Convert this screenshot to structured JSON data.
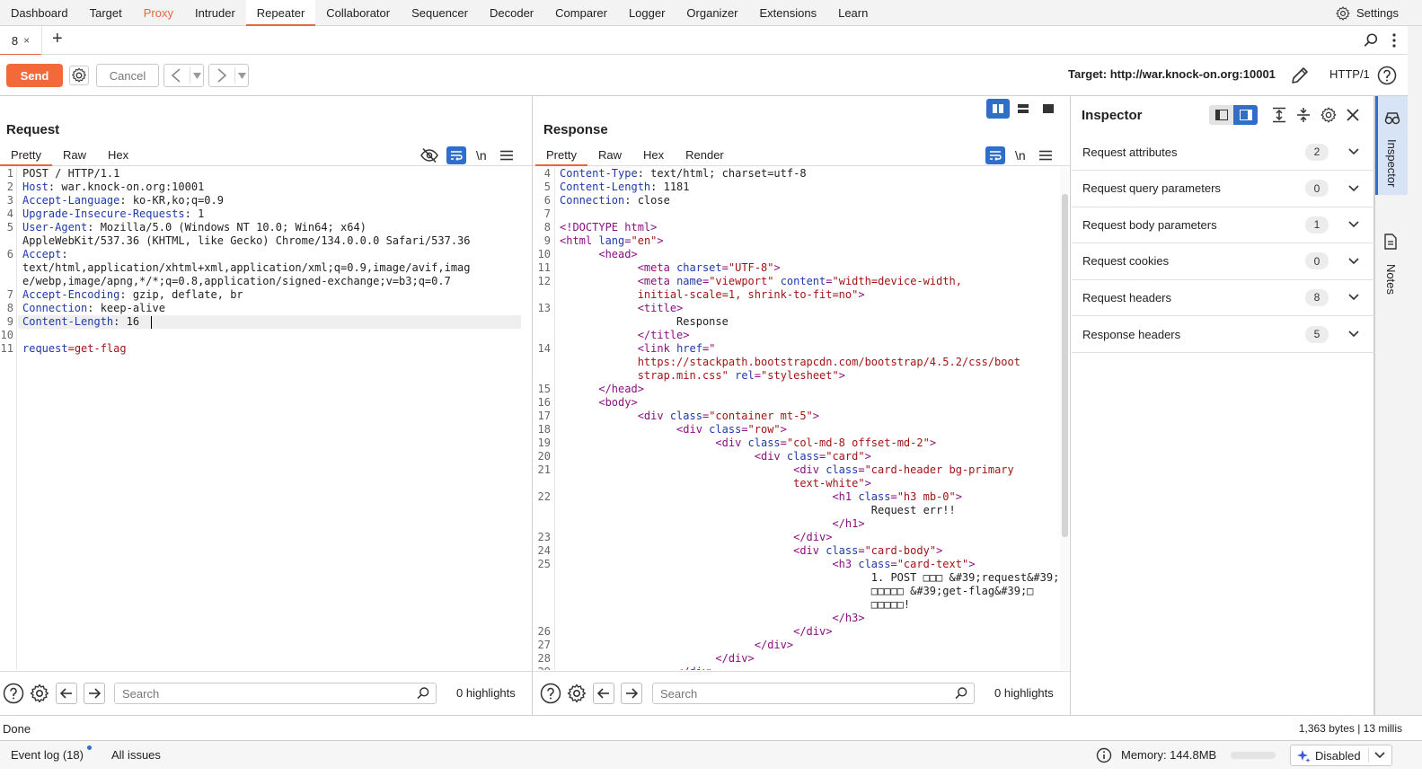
{
  "nav": {
    "tabs": [
      "Dashboard",
      "Target",
      "Proxy",
      "Intruder",
      "Repeater",
      "Collaborator",
      "Sequencer",
      "Decoder",
      "Comparer",
      "Logger",
      "Organizer",
      "Extensions",
      "Learn"
    ],
    "active": "Repeater",
    "highlighted": "Proxy",
    "settings": "Settings"
  },
  "tabstrip": {
    "tab_label": "8",
    "close": "×",
    "add": "+"
  },
  "toolbar": {
    "send": "Send",
    "cancel": "Cancel",
    "target": "Target: http://war.knock-on.org:10001",
    "protocol": "HTTP/1"
  },
  "request": {
    "title": "Request",
    "tabs": [
      "Pretty",
      "Raw",
      "Hex"
    ],
    "active_tab": "Pretty",
    "newline_label": "\\n",
    "lines": [
      {
        "n": "1",
        "parts": [
          [
            "POST / HTTP/1.1",
            ""
          ]
        ]
      },
      {
        "n": "2",
        "parts": [
          [
            "Host",
            "key"
          ],
          [
            ": war.knock-on.org:10001",
            ""
          ]
        ]
      },
      {
        "n": "3",
        "parts": [
          [
            "Accept-Language",
            "key"
          ],
          [
            ": ko-KR,ko;q=0.9",
            ""
          ]
        ]
      },
      {
        "n": "4",
        "parts": [
          [
            "Upgrade-Insecure-Requests",
            "key"
          ],
          [
            ": 1",
            ""
          ]
        ]
      },
      {
        "n": "5",
        "parts": [
          [
            "User-Agent",
            "key"
          ],
          [
            ": Mozilla/5.0 (Windows NT 10.0; Win64; x64)",
            ""
          ]
        ]
      },
      {
        "n": "",
        "parts": [
          [
            "AppleWebKit/537.36 (KHTML, like Gecko) Chrome/134.0.0.0 Safari/537.36",
            ""
          ]
        ]
      },
      {
        "n": "6",
        "parts": [
          [
            "Accept",
            "key"
          ],
          [
            ":",
            ""
          ]
        ]
      },
      {
        "n": "",
        "parts": [
          [
            "text/html,application/xhtml+xml,application/xml;q=0.9,image/avif,imag",
            ""
          ]
        ]
      },
      {
        "n": "",
        "parts": [
          [
            "e/webp,image/apng,*/*;q=0.8,application/signed-exchange;v=b3;q=0.7",
            ""
          ]
        ]
      },
      {
        "n": "7",
        "parts": [
          [
            "Accept-Encoding",
            "key"
          ],
          [
            ": gzip, deflate, br",
            ""
          ]
        ]
      },
      {
        "n": "8",
        "parts": [
          [
            "Connection",
            "key"
          ],
          [
            ": keep-alive",
            ""
          ]
        ]
      },
      {
        "n": "9",
        "parts": [
          [
            "Content-Length",
            "key"
          ],
          [
            ": 16",
            ""
          ]
        ]
      },
      {
        "n": "10",
        "parts": [
          [
            "",
            ""
          ]
        ]
      },
      {
        "n": "11",
        "parts": [
          [
            "request",
            "key"
          ],
          [
            "=",
            "str"
          ],
          [
            "get-flag",
            "str"
          ]
        ]
      }
    ],
    "search_placeholder": "Search",
    "highlights": "0 highlights"
  },
  "response": {
    "title": "Response",
    "tabs": [
      "Pretty",
      "Raw",
      "Hex",
      "Render"
    ],
    "active_tab": "Pretty",
    "newline_label": "\\n",
    "lines": [
      {
        "n": "4",
        "parts": [
          [
            "Content-Type",
            "key"
          ],
          [
            ": text/html; charset=utf-8",
            ""
          ]
        ]
      },
      {
        "n": "5",
        "parts": [
          [
            "Content-Length",
            "key"
          ],
          [
            ": 1181",
            ""
          ]
        ]
      },
      {
        "n": "6",
        "parts": [
          [
            "Connection",
            "key"
          ],
          [
            ": close",
            ""
          ]
        ]
      },
      {
        "n": "7",
        "parts": [
          [
            "",
            ""
          ]
        ]
      },
      {
        "n": "8",
        "parts": [
          [
            "<!DOCTYPE html>",
            "tag"
          ]
        ]
      },
      {
        "n": "9",
        "parts": [
          [
            "<html ",
            "tag"
          ],
          [
            "lang",
            "attr"
          ],
          [
            "=",
            "tag"
          ],
          [
            "\"en\"",
            "val"
          ],
          [
            ">",
            "tag"
          ]
        ]
      },
      {
        "n": "10",
        "parts": [
          [
            "      ",
            ""
          ],
          [
            "<head>",
            "tag"
          ]
        ]
      },
      {
        "n": "11",
        "parts": [
          [
            "            ",
            ""
          ],
          [
            "<meta ",
            "tag"
          ],
          [
            "charset",
            "attr"
          ],
          [
            "=",
            "tag"
          ],
          [
            "\"UTF-8\"",
            "val"
          ],
          [
            ">",
            "tag"
          ]
        ]
      },
      {
        "n": "12",
        "parts": [
          [
            "            ",
            ""
          ],
          [
            "<meta ",
            "tag"
          ],
          [
            "name",
            "attr"
          ],
          [
            "=",
            "tag"
          ],
          [
            "\"viewport\"",
            "val"
          ],
          [
            " ",
            ""
          ],
          [
            "content",
            "attr"
          ],
          [
            "=",
            "tag"
          ],
          [
            "\"width=device-width,",
            "val"
          ]
        ]
      },
      {
        "n": "",
        "parts": [
          [
            "            ",
            ""
          ],
          [
            "initial-scale=1, shrink-to-fit=no\"",
            "val"
          ],
          [
            ">",
            "tag"
          ]
        ]
      },
      {
        "n": "13",
        "parts": [
          [
            "            ",
            ""
          ],
          [
            "<title>",
            "tag"
          ]
        ]
      },
      {
        "n": "",
        "parts": [
          [
            "                  Response",
            ""
          ]
        ]
      },
      {
        "n": "",
        "parts": [
          [
            "            ",
            ""
          ],
          [
            "</title>",
            "tag"
          ]
        ]
      },
      {
        "n": "14",
        "parts": [
          [
            "            ",
            ""
          ],
          [
            "<link ",
            "tag"
          ],
          [
            "href",
            "attr"
          ],
          [
            "=\"",
            "tag"
          ]
        ]
      },
      {
        "n": "",
        "parts": [
          [
            "            ",
            ""
          ],
          [
            "https://stackpath.bootstrapcdn.com/bootstrap/4.5.2/css/boot",
            "val"
          ]
        ]
      },
      {
        "n": "",
        "parts": [
          [
            "            ",
            ""
          ],
          [
            "strap.min.css\"",
            "val"
          ],
          [
            " ",
            ""
          ],
          [
            "rel",
            "attr"
          ],
          [
            "=",
            "tag"
          ],
          [
            "\"stylesheet\"",
            "val"
          ],
          [
            ">",
            "tag"
          ]
        ]
      },
      {
        "n": "15",
        "parts": [
          [
            "      ",
            ""
          ],
          [
            "</head>",
            "tag"
          ]
        ]
      },
      {
        "n": "16",
        "parts": [
          [
            "      ",
            ""
          ],
          [
            "<body>",
            "tag"
          ]
        ]
      },
      {
        "n": "17",
        "parts": [
          [
            "            ",
            ""
          ],
          [
            "<div ",
            "tag"
          ],
          [
            "class",
            "attr"
          ],
          [
            "=",
            "tag"
          ],
          [
            "\"container mt-5\"",
            "val"
          ],
          [
            ">",
            "tag"
          ]
        ]
      },
      {
        "n": "18",
        "parts": [
          [
            "                  ",
            ""
          ],
          [
            "<div ",
            "tag"
          ],
          [
            "class",
            "attr"
          ],
          [
            "=",
            "tag"
          ],
          [
            "\"row\"",
            "val"
          ],
          [
            ">",
            "tag"
          ]
        ]
      },
      {
        "n": "19",
        "parts": [
          [
            "                        ",
            ""
          ],
          [
            "<div ",
            "tag"
          ],
          [
            "class",
            "attr"
          ],
          [
            "=",
            "tag"
          ],
          [
            "\"col-md-8 offset-md-2\"",
            "val"
          ],
          [
            ">",
            "tag"
          ]
        ]
      },
      {
        "n": "20",
        "parts": [
          [
            "                              ",
            ""
          ],
          [
            "<div ",
            "tag"
          ],
          [
            "class",
            "attr"
          ],
          [
            "=",
            "tag"
          ],
          [
            "\"card\"",
            "val"
          ],
          [
            ">",
            "tag"
          ]
        ]
      },
      {
        "n": "21",
        "parts": [
          [
            "                                    ",
            ""
          ],
          [
            "<div ",
            "tag"
          ],
          [
            "class",
            "attr"
          ],
          [
            "=",
            "tag"
          ],
          [
            "\"card-header bg-primary",
            "val"
          ]
        ]
      },
      {
        "n": "",
        "parts": [
          [
            "                                    ",
            ""
          ],
          [
            "text-white\"",
            "val"
          ],
          [
            ">",
            "tag"
          ]
        ]
      },
      {
        "n": "22",
        "parts": [
          [
            "                                          ",
            ""
          ],
          [
            "<h1 ",
            "tag"
          ],
          [
            "class",
            "attr"
          ],
          [
            "=",
            "tag"
          ],
          [
            "\"h3 mb-0\"",
            "val"
          ],
          [
            ">",
            "tag"
          ]
        ]
      },
      {
        "n": "",
        "parts": [
          [
            "                                                Request err!!",
            ""
          ]
        ]
      },
      {
        "n": "",
        "parts": [
          [
            "                                          ",
            ""
          ],
          [
            "</h1>",
            "tag"
          ]
        ]
      },
      {
        "n": "23",
        "parts": [
          [
            "                                    ",
            ""
          ],
          [
            "</div>",
            "tag"
          ]
        ]
      },
      {
        "n": "24",
        "parts": [
          [
            "                                    ",
            ""
          ],
          [
            "<div ",
            "tag"
          ],
          [
            "class",
            "attr"
          ],
          [
            "=",
            "tag"
          ],
          [
            "\"card-body\"",
            "val"
          ],
          [
            ">",
            "tag"
          ]
        ]
      },
      {
        "n": "25",
        "parts": [
          [
            "                                          ",
            ""
          ],
          [
            "<h3 ",
            "tag"
          ],
          [
            "class",
            "attr"
          ],
          [
            "=",
            "tag"
          ],
          [
            "\"card-text\"",
            "val"
          ],
          [
            ">",
            "tag"
          ]
        ]
      },
      {
        "n": "",
        "parts": [
          [
            "                                                1. POST □□□ &#39;request&#39;",
            ""
          ]
        ]
      },
      {
        "n": "",
        "parts": [
          [
            "                                                □□□□□ &#39;get-flag&#39;□",
            ""
          ]
        ]
      },
      {
        "n": "",
        "parts": [
          [
            "                                                □□□□□!",
            ""
          ]
        ]
      },
      {
        "n": "",
        "parts": [
          [
            "                                          ",
            ""
          ],
          [
            "</h3>",
            "tag"
          ]
        ]
      },
      {
        "n": "26",
        "parts": [
          [
            "                                    ",
            ""
          ],
          [
            "</div>",
            "tag"
          ]
        ]
      },
      {
        "n": "27",
        "parts": [
          [
            "                              ",
            ""
          ],
          [
            "</div>",
            "tag"
          ]
        ]
      },
      {
        "n": "28",
        "parts": [
          [
            "                        ",
            ""
          ],
          [
            "</div>",
            "tag"
          ]
        ]
      },
      {
        "n": "29",
        "parts": [
          [
            "                  ",
            ""
          ],
          [
            "</div>",
            "tag"
          ]
        ]
      }
    ],
    "search_placeholder": "Search",
    "highlights": "0 highlights"
  },
  "inspector": {
    "title": "Inspector",
    "rows": [
      {
        "label": "Request attributes",
        "count": "2"
      },
      {
        "label": "Request query parameters",
        "count": "0"
      },
      {
        "label": "Request body parameters",
        "count": "1"
      },
      {
        "label": "Request cookies",
        "count": "0"
      },
      {
        "label": "Request headers",
        "count": "8"
      },
      {
        "label": "Response headers",
        "count": "5"
      }
    ]
  },
  "rail": {
    "inspector": "Inspector",
    "notes": "Notes"
  },
  "status": {
    "left": "Done",
    "right": "1,363 bytes | 13 millis"
  },
  "bottombar": {
    "event_log": "Event log (18)",
    "all_issues": "All issues",
    "memory": "Memory: 144.8MB",
    "ai_state": "Disabled"
  },
  "colors": {
    "accent": "#e8663b",
    "send": "#f26a3a",
    "blue": "#2f6fc9",
    "tag": "#8a0f80",
    "key": "#1f3aa8",
    "value": "#a11515"
  }
}
